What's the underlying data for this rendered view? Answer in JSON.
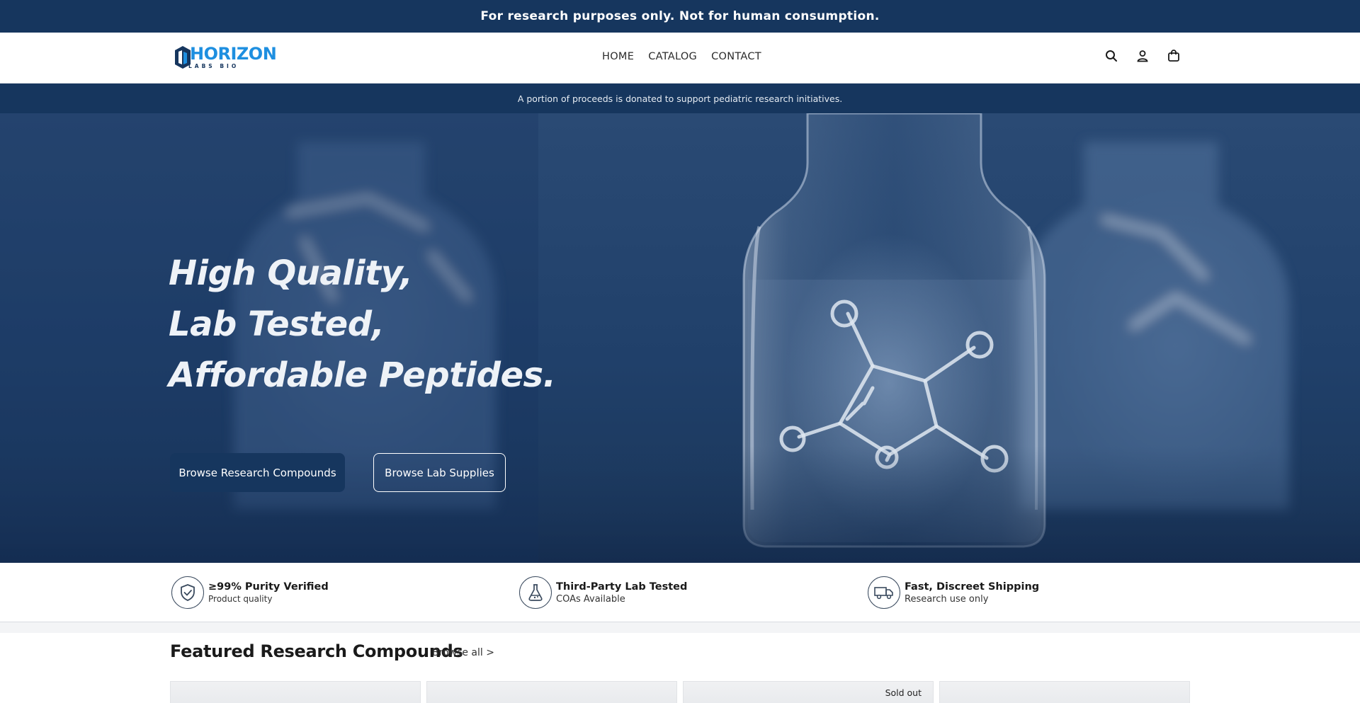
{
  "announcement": {
    "text": "For research purposes only. Not for human consumption."
  },
  "header": {
    "logo": {
      "word": "HORIZON",
      "tagline": "LABS BIO"
    },
    "nav": [
      {
        "label": "HOME"
      },
      {
        "label": "CATALOG"
      },
      {
        "label": "CONTACT"
      }
    ],
    "icons": [
      "search-icon",
      "account-icon",
      "cart-icon"
    ]
  },
  "donation_banner": {
    "text": "A portion of proceeds is donated to support pediatric research initiatives."
  },
  "hero": {
    "headline": [
      "High Quality,",
      "Lab Tested,",
      "Affordable Peptides."
    ],
    "primary_button": "Browse Research Compounds",
    "secondary_button": "Browse Lab Supplies"
  },
  "features": [
    {
      "icon": "shield-check-icon",
      "title": "≥99% Purity Verified",
      "subtitle": "Product quality"
    },
    {
      "icon": "flask-icon",
      "title": "Third-Party Lab Tested",
      "subtitle": "COAs Available"
    },
    {
      "icon": "truck-icon",
      "title": "Fast, Discreet Shipping",
      "subtitle": "Research use only"
    }
  ],
  "featured": {
    "title": "Featured Research Compounds",
    "browse_all": "Browse all >",
    "cards": [
      {
        "badge": ""
      },
      {
        "badge": ""
      },
      {
        "badge": "Sold out"
      },
      {
        "badge": ""
      }
    ]
  },
  "colors": {
    "navy": "#16365e",
    "brand_blue": "#1e8fe0",
    "white": "#ffffff"
  }
}
